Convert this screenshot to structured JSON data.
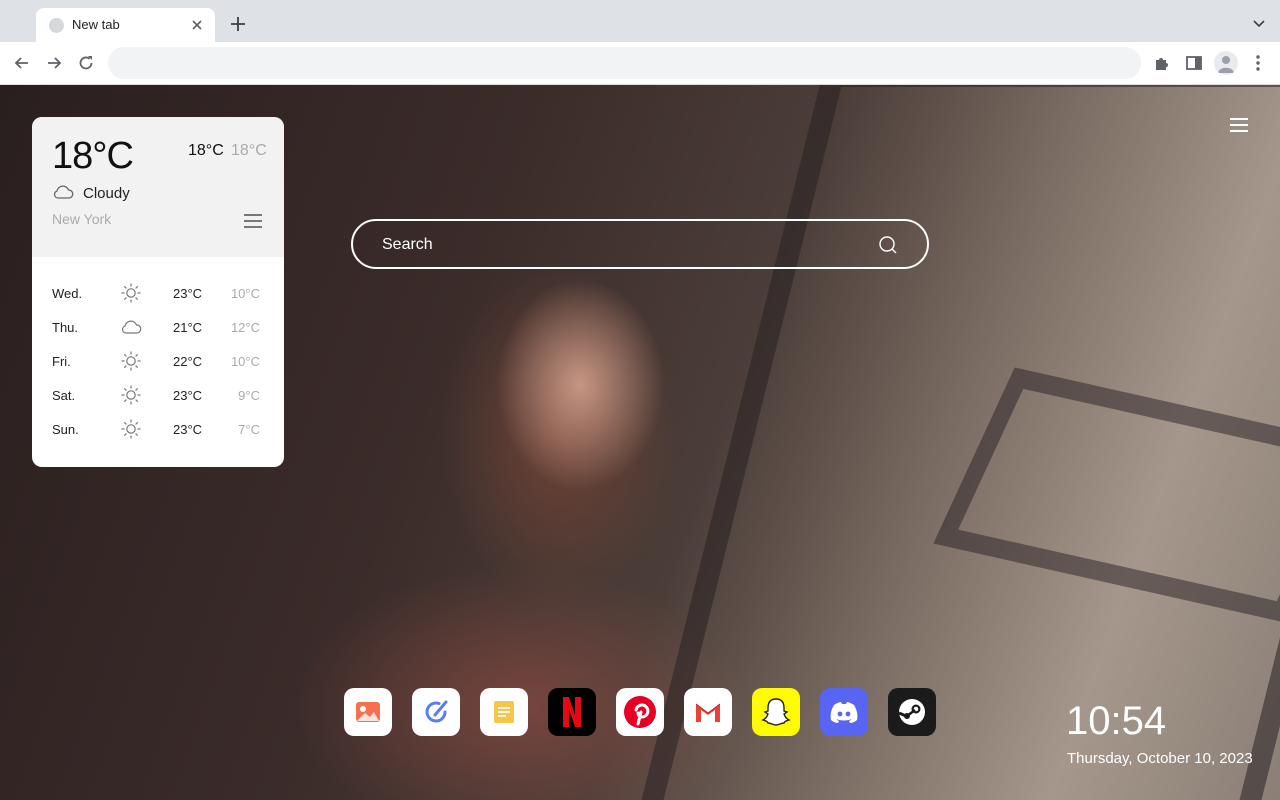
{
  "browser": {
    "tab_title": "New tab",
    "omnibox_value": ""
  },
  "weather": {
    "current_temp": "18°C",
    "high": "18°C",
    "low": "18°C",
    "condition": "Cloudy",
    "condition_icon": "cloud-icon",
    "city": "New York",
    "forecast": [
      {
        "day": "Wed.",
        "icon": "sun-icon",
        "high": "23°C",
        "low": "10°C"
      },
      {
        "day": "Thu.",
        "icon": "cloud-icon",
        "high": "21°C",
        "low": "12°C"
      },
      {
        "day": "Fri.",
        "icon": "sun-icon",
        "high": "22°C",
        "low": "10°C"
      },
      {
        "day": "Sat.",
        "icon": "sun-icon",
        "high": "23°C",
        "low": "9°C"
      },
      {
        "day": "Sun.",
        "icon": "sun-icon",
        "high": "23°C",
        "low": "7°C"
      }
    ]
  },
  "search": {
    "placeholder": "Search"
  },
  "shortcuts": [
    {
      "name": "gallery",
      "icon": "image-icon",
      "color": "#ffffff"
    },
    {
      "name": "edit",
      "icon": "pencil-circle-icon",
      "color": "#ffffff"
    },
    {
      "name": "notes",
      "icon": "notes-icon",
      "color": "#ffffff"
    },
    {
      "name": "netflix",
      "icon": "netflix-icon",
      "color": "#000000"
    },
    {
      "name": "pinterest",
      "icon": "pinterest-icon",
      "color": "#ffffff"
    },
    {
      "name": "gmail",
      "icon": "gmail-icon",
      "color": "#ffffff"
    },
    {
      "name": "snapchat",
      "icon": "snapchat-icon",
      "color": "#fffc00"
    },
    {
      "name": "discord",
      "icon": "discord-icon",
      "color": "#5865f2"
    },
    {
      "name": "steam",
      "icon": "steam-icon",
      "color": "#1b1b1b"
    }
  ],
  "clock": {
    "time": "10:54",
    "date": "Thursday, October 10, 2023"
  }
}
